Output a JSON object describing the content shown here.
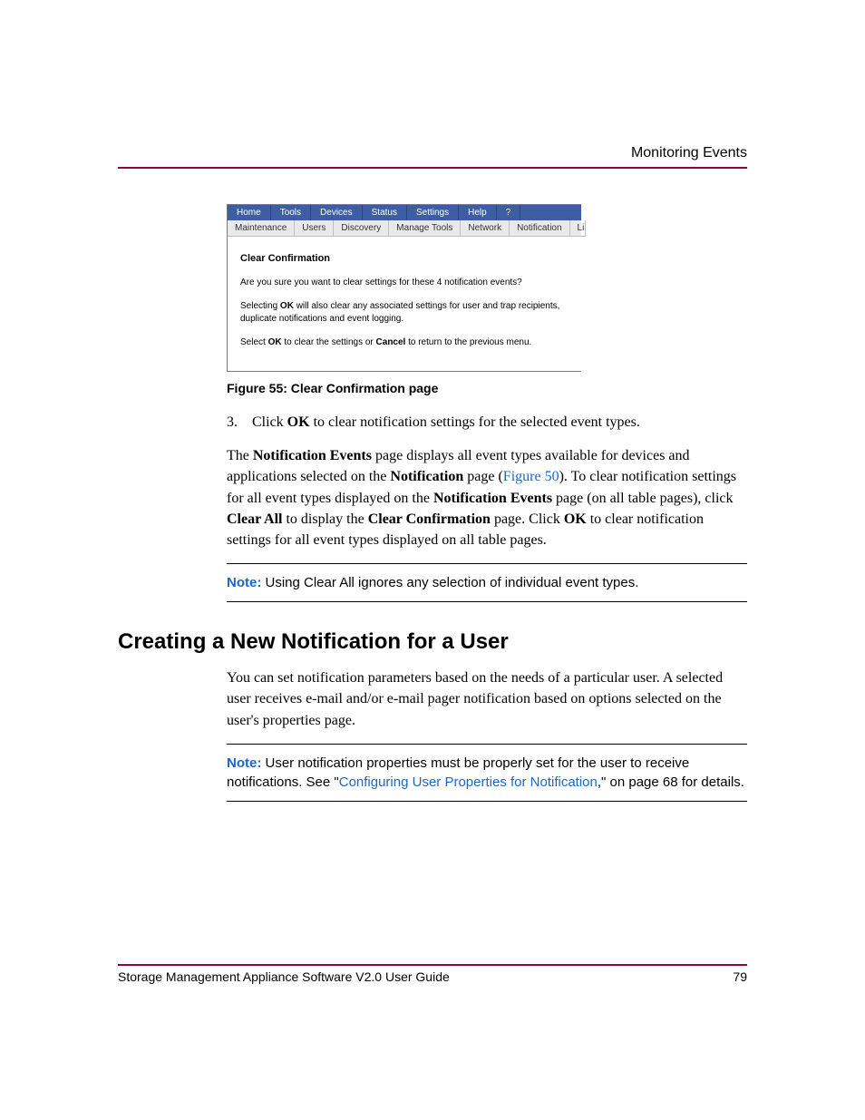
{
  "header": {
    "title": "Monitoring Events"
  },
  "screenshot": {
    "nav": [
      "Home",
      "Tools",
      "Devices",
      "Status",
      "Settings",
      "Help",
      "?"
    ],
    "subnav": [
      "Maintenance",
      "Users",
      "Discovery",
      "Manage Tools",
      "Network",
      "Notification",
      "Li"
    ],
    "dialog_title": "Clear Confirmation",
    "line1": "Are you sure you want to clear settings for these 4 notification events?",
    "line2a": "Selecting ",
    "line2b": "OK",
    "line2c": " will also clear any associated settings for user and trap recipients, duplicate notifications and event logging.",
    "line3a": "Select ",
    "line3b": "OK",
    "line3c": " to clear the settings or ",
    "line3d": "Cancel",
    "line3e": " to return to the previous menu."
  },
  "figure_caption": "Figure 55:  Clear Confirmation page",
  "step": {
    "num": "3.",
    "a": "Click ",
    "b": "OK",
    "c": " to clear notification settings for the selected event types."
  },
  "para1": {
    "a": "The ",
    "b": "Notification Events",
    "c": " page displays all event types available for devices and applications selected on the ",
    "d": "Notification",
    "e": " page (",
    "f": "Figure 50",
    "g": "). To clear notification settings for all event types displayed on the ",
    "h": "Notification Events",
    "i": " page (on all table pages), click ",
    "j": "Clear All",
    "k": " to display the ",
    "l": "Clear Confirmation",
    "m": " page. Click ",
    "n": "OK",
    "o": " to clear notification settings for all event types displayed on all table pages."
  },
  "note1": {
    "label": "Note:",
    "text": "  Using Clear All ignores any selection of individual event types."
  },
  "section_heading": "Creating a New Notification for a User",
  "para2": "You can set notification parameters based on the needs of a particular user. A selected user receives e-mail and/or e-mail pager notification based on options selected on the user's properties page.",
  "note2": {
    "label": "Note:",
    "a": "  User notification properties must be properly set for the user to receive notifications. See \"",
    "link": "Configuring User Properties for Notification",
    "b": ",\" on page 68 for details."
  },
  "footer": {
    "left": "Storage Management Appliance Software V2.0 User Guide",
    "right": "79"
  }
}
